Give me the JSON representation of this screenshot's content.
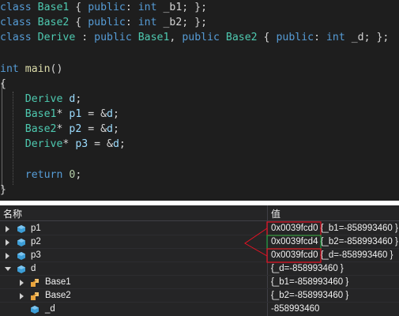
{
  "code": {
    "line1": {
      "kw": "class",
      "type": "Base1",
      "p1": " { ",
      "kw2": "public",
      "p2": ": ",
      "kw3": "int",
      "p3": " _b1; };"
    },
    "line2": {
      "kw": "class",
      "type": "Base2",
      "p1": " { ",
      "kw2": "public",
      "p2": ": ",
      "kw3": "int",
      "p3": " _b2; };"
    },
    "line3": {
      "kw": "class",
      "type": "Derive",
      "p1": " : ",
      "kw2": "public",
      "type2": "Base1",
      "p2": ", ",
      "kw3": "public",
      "type3": "Base2",
      "p3": " { ",
      "kw4": "public",
      "p4": ": ",
      "kw5": "int",
      "p5": " _d; };"
    },
    "main_sig": {
      "kw": "int",
      "fn": "main",
      "rest": "()"
    },
    "open_brace": "{",
    "decl_d": {
      "type": "Derive",
      "var": "d",
      "end": ";"
    },
    "decl_p1": {
      "type": "Base1",
      "star": "*",
      "var": "p1",
      "rest": " = &",
      "ref": "d",
      "end": ";"
    },
    "decl_p2": {
      "type": "Base2",
      "star": "*",
      "var": "p2",
      "rest": " = &",
      "ref": "d",
      "end": ";"
    },
    "decl_p3": {
      "type": "Derive",
      "star": "*",
      "var": "p3",
      "rest": " = &",
      "ref": "d",
      "end": ";"
    },
    "ret": {
      "kw": "return",
      "num": "0",
      "end": ";"
    },
    "close_brace": "}"
  },
  "watch": {
    "header_name": "名称",
    "header_value": "值",
    "rows": [
      {
        "name": "p1",
        "addr": "0x0039fcd0",
        "rest": " {_b1=-858993460 }"
      },
      {
        "name": "p2",
        "addr": "0x0039fcd4",
        "rest": " {_b2=-858993460 }"
      },
      {
        "name": "p3",
        "addr": "0x0039fcd0",
        "rest": " {_d=-858993460 }"
      },
      {
        "name": "d",
        "value": "{_d=-858993460 }"
      },
      {
        "name": "Base1",
        "value": "{_b1=-858993460 }"
      },
      {
        "name": "Base2",
        "value": "{_b2=-858993460 }"
      },
      {
        "name": "_d",
        "value": "-858993460"
      }
    ]
  },
  "colors": {
    "annotation_red": "#e81123",
    "annotation_green": "#1e9e3e",
    "pointer_icon": "#3c9dd6",
    "class_icon": "#e8a33d"
  }
}
